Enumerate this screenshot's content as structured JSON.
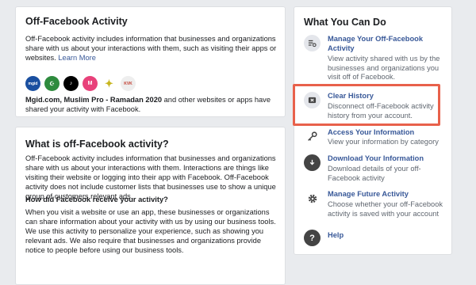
{
  "off_facebook": {
    "title": "Off-Facebook Activity",
    "description": "Off-Facebook activity includes information that businesses and organizations share with us about your interactions with them, such as visiting their apps or websites.",
    "learn_more": "Learn More",
    "apps": [
      {
        "icon": "mgid-icon",
        "label": "mgid",
        "color": "#1a4fa0"
      },
      {
        "icon": "muslim-pro-icon",
        "label": "☪",
        "color": "#2e8b3e"
      },
      {
        "icon": "tiktok-icon",
        "label": "♪",
        "color": "#000000"
      },
      {
        "icon": "pink-m-icon",
        "label": "M",
        "color": "#e8417a"
      },
      {
        "icon": "yellow-figure-icon",
        "label": "✦",
        "color": "#c8b61f"
      },
      {
        "icon": "kvk-icon",
        "label": "KVK",
        "color": "#d9d9d9"
      }
    ],
    "apps_names": "Mgid.com, Muslim Pro - Ramadan 2020",
    "apps_suffix": " and other websites or apps have shared your activity with Facebook."
  },
  "what_is": {
    "title": "What is off-Facebook activity?",
    "paragraph": "Off-Facebook activity includes information that businesses and organizations share with us about your interactions with them. Interactions are things like visiting their website or logging into their app with Facebook. Off-Facebook activity does not include customer lists that businesses use to show a unique group of customers relevant ads.",
    "subheading": "How did Facebook receive your activity?",
    "paragraph2": "When you visit a website or use an app, these businesses or organizations can share information about your activity with us by using our business tools. We use this activity to personalize your experience, such as showing you relevant ads. We also require that businesses and organizations provide notice to people before using our business tools."
  },
  "what_you_can_do": {
    "title": "What You Can Do",
    "actions": [
      {
        "title": "Manage Your Off-Facebook Activity",
        "desc": "View activity shared with us by the businesses and organizations you visit off of Facebook."
      },
      {
        "title": "Clear History",
        "desc": "Disconnect off-Facebook activity history from your account."
      },
      {
        "title": "Access Your Information",
        "desc": "View your information by category"
      },
      {
        "title": "Download Your Information",
        "desc": "Download details of your off-Facebook activity"
      },
      {
        "title": "Manage Future Activity",
        "desc": "Choose whether your off-Facebook activity is saved with your account"
      },
      {
        "title": "Help",
        "desc": ""
      }
    ]
  },
  "colors": {
    "highlight": "#e8614b",
    "link": "#385898"
  }
}
